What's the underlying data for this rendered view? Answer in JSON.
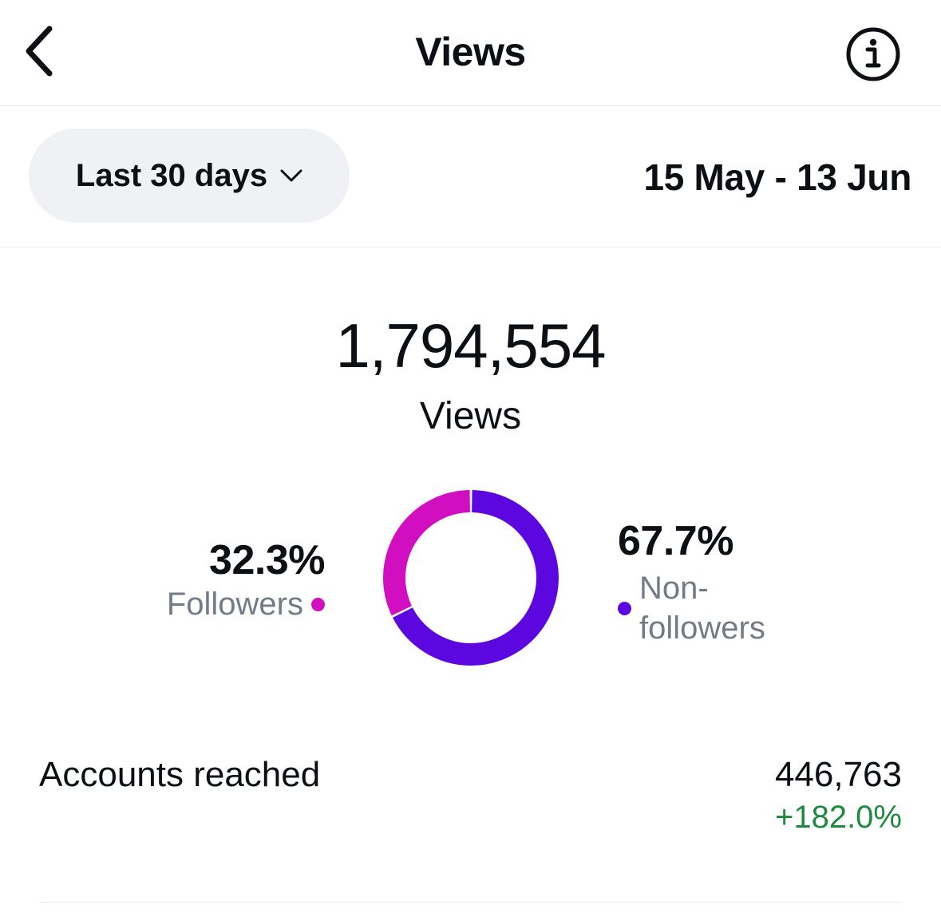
{
  "header": {
    "title": "Views",
    "back_icon": "chevron-left-icon",
    "info_icon": "info-icon"
  },
  "filter": {
    "range_label": "Last 30 days",
    "range_icon": "chevron-down-icon",
    "date_range": "15 May - 13 Jun"
  },
  "summary": {
    "total": "1,794,554",
    "total_label": "Views"
  },
  "chart_data": {
    "type": "pie",
    "style": "donut",
    "slices": [
      {
        "name": "Followers",
        "value": 32.3,
        "label": "32.3%",
        "color": "#d20ec1"
      },
      {
        "name": "Non-followers",
        "value": 67.7,
        "label": "67.7%",
        "color": "#5c07e0"
      }
    ],
    "legend": {
      "followers_label": "Followers",
      "non_followers_line1": "Non-",
      "non_followers_line2": "followers"
    }
  },
  "metrics": [
    {
      "label": "Accounts reached",
      "value": "446,763",
      "change": "+182.0%",
      "change_color": "#1e8a3e"
    }
  ]
}
